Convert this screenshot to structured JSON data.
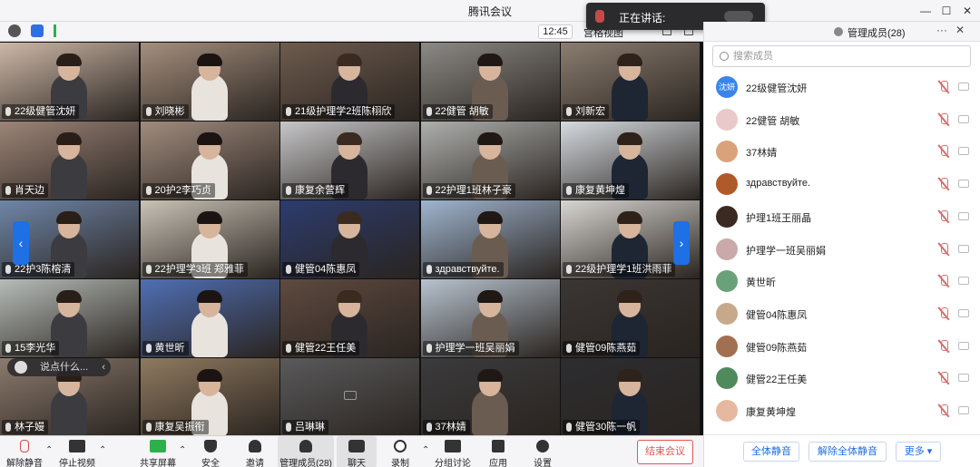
{
  "window": {
    "title": "腾讯会议"
  },
  "toolbar": {
    "clock": "12:45",
    "gallery_view": "宫格视图",
    "chat_tab": "聊天"
  },
  "speaking": {
    "label": "正在讲话:"
  },
  "tiles": [
    {
      "name": "22级健管沈妍",
      "bg": "#cdb8a8"
    },
    {
      "name": "刘晓彬",
      "bg": "#a58f7e"
    },
    {
      "name": "21级护理学2班陈栩欣",
      "bg": "#6d5b4e"
    },
    {
      "name": "22健管 胡敏",
      "bg": "#8c8a86"
    },
    {
      "name": "刘新宏",
      "bg": "#8b7d70"
    },
    {
      "name": "肖天边",
      "bg": "#9c8477"
    },
    {
      "name": "20护2李巧贞",
      "bg": "#a18c7e"
    },
    {
      "name": "康复余营辉",
      "bg": "#c7c7c9"
    },
    {
      "name": "22护理1班林子豪",
      "bg": "#aeb0ae"
    },
    {
      "name": "康复黄坤煌",
      "bg": "#d6dbe0"
    },
    {
      "name": "22护3陈榕清",
      "bg": "#6f86a8"
    },
    {
      "name": "22护理学3班 郑雅菲",
      "bg": "#c9c2b6"
    },
    {
      "name": "健管04陈惠凤",
      "bg": "#2c3c6e"
    },
    {
      "name": "здравствуйте.",
      "bg": "#9fb5cf"
    },
    {
      "name": "22级护理学1班洪雨菲",
      "bg": "#d8d6d2"
    },
    {
      "name": "15李光华",
      "bg": "#b6bcb8"
    },
    {
      "name": "黄世昕",
      "bg": "#4f6fb5"
    },
    {
      "name": "健管22王任美",
      "bg": "#5e4a40"
    },
    {
      "name": "护理学一班吴丽娟",
      "bg": "#b7c3cf"
    },
    {
      "name": "健管09陈燕茹",
      "bg": "#3a3633"
    },
    {
      "name": "林子嫚",
      "bg": "#8b7a6d"
    },
    {
      "name": "康复吴振衔",
      "bg": "#8f7a5f"
    },
    {
      "name": "吕琳琳",
      "bg": "#5a5a5c"
    },
    {
      "name": "37林婧",
      "bg": "#3b3b3d"
    },
    {
      "name": "健管30陈一帆",
      "bg": "#2d2d30"
    }
  ],
  "quick_chat": {
    "placeholder": "说点什么..."
  },
  "controls": {
    "unmute": "解除静音",
    "stop_video": "停止视频",
    "share": "共享屏幕",
    "security": "安全",
    "invite": "邀请",
    "members": "管理成员(28)",
    "chat": "聊天",
    "record": "录制",
    "breakout": "分组讨论",
    "apps": "应用",
    "settings": "设置",
    "end": "结束会议"
  },
  "panel": {
    "title": "管理成员(28)",
    "search_placeholder": "搜索成员",
    "members": [
      {
        "name": "22级健管沈妍",
        "avatar_text": "沈妍",
        "avatar_color": "#3a86e8"
      },
      {
        "name": "22健管 胡敏",
        "avatar_text": "",
        "avatar_color": "#e9c9c9"
      },
      {
        "name": "37林婧",
        "avatar_text": "",
        "avatar_color": "#d9a27a"
      },
      {
        "name": "здравствуйте.",
        "avatar_text": "",
        "avatar_color": "#b05a2a"
      },
      {
        "name": "护理1班王丽晶",
        "avatar_text": "",
        "avatar_color": "#3a2a22"
      },
      {
        "name": "护理学一班吴丽娟",
        "avatar_text": "",
        "avatar_color": "#c9a9a9"
      },
      {
        "name": "黄世昕",
        "avatar_text": "",
        "avatar_color": "#6aa07a"
      },
      {
        "name": "健管04陈惠凤",
        "avatar_text": "",
        "avatar_color": "#c6a98a"
      },
      {
        "name": "健管09陈燕茹",
        "avatar_text": "",
        "avatar_color": "#a27050"
      },
      {
        "name": "健管22王任美",
        "avatar_text": "",
        "avatar_color": "#4f8a5c"
      },
      {
        "name": "康复黄坤煌",
        "avatar_text": "",
        "avatar_color": "#e6b8a0"
      }
    ],
    "mute_all": "全体静音",
    "unmute_all": "解除全体静音",
    "more": "更多"
  }
}
